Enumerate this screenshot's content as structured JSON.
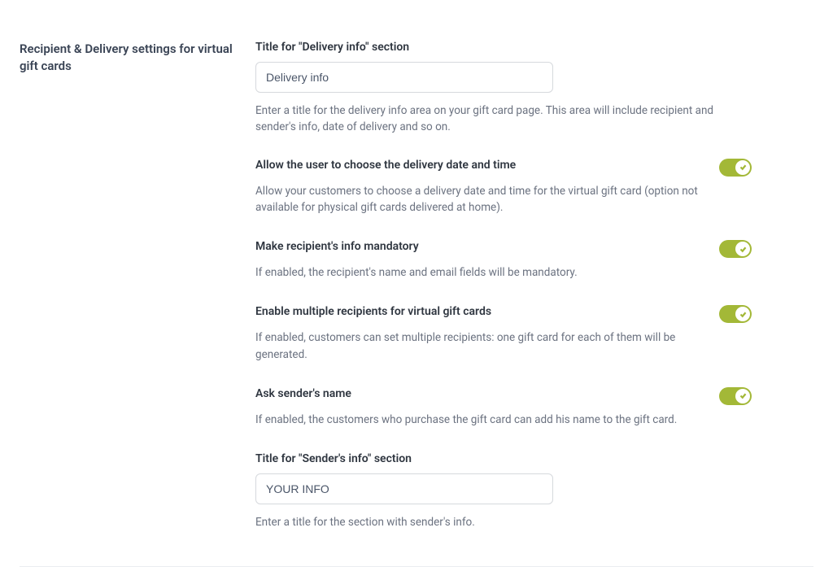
{
  "sidebar": {
    "title": "Recipient & Delivery settings for virtual gift cards"
  },
  "deliveryTitle": {
    "label": "Title for \"Delivery info\" section",
    "value": "Delivery info",
    "help": "Enter a title for the delivery info area on your gift card page. This area will include recipient and sender's info, date of delivery and so on."
  },
  "allowDate": {
    "label": "Allow the user to choose the delivery date and time",
    "help": "Allow your customers to choose a delivery date and time for the virtual gift card (option not available for physical gift cards delivered at home).",
    "enabled": true
  },
  "mandatoryRecipient": {
    "label": "Make recipient's info mandatory",
    "help": "If enabled, the recipient's name and email fields will be mandatory.",
    "enabled": true
  },
  "multipleRecipients": {
    "label": "Enable multiple recipients for virtual gift cards",
    "help": "If enabled, customers can set multiple recipients: one gift card for each of them will be generated.",
    "enabled": true
  },
  "askSender": {
    "label": "Ask sender's name",
    "help": "If enabled, the customers who purchase the gift card can add his name to the gift card.",
    "enabled": true
  },
  "senderTitle": {
    "label": "Title for \"Sender's info\" section",
    "value": "YOUR INFO",
    "help": "Enter a title for the section with sender's info."
  }
}
